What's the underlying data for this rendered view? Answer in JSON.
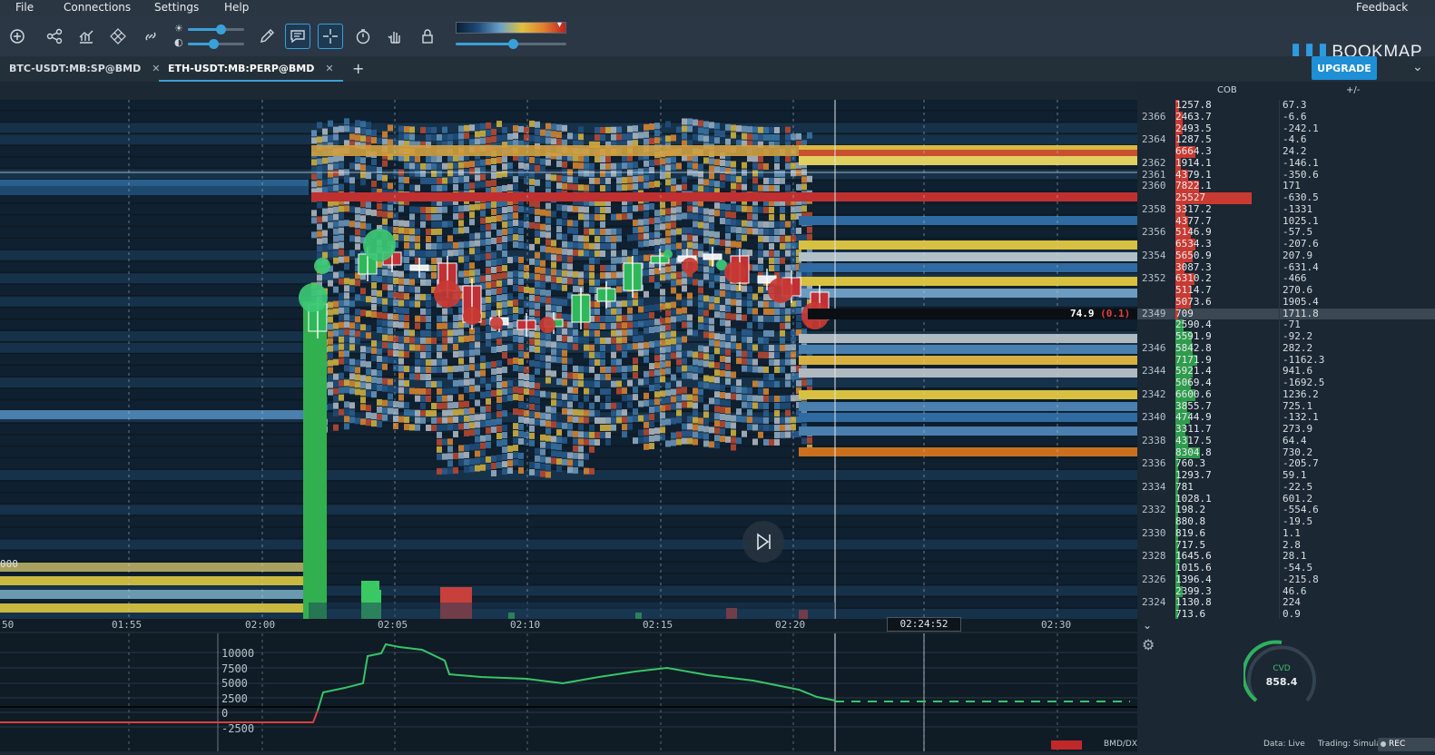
{
  "menu": {
    "file": "File",
    "connections": "Connections",
    "settings": "Settings",
    "help": "Help",
    "feedback": "Feedback"
  },
  "brand": {
    "logo": "BOOKMAP",
    "upgrade": "UPGRADE"
  },
  "tabs": [
    {
      "label": "BTC-USDT:MB:SP@BMD",
      "active": false
    },
    {
      "label": "ETH-USDT:MB:PERP@BMD",
      "active": true
    }
  ],
  "time_axis": {
    "ticks": [
      "50",
      "01:55",
      "02:00",
      "02:05",
      "02:10",
      "02:15",
      "02:20",
      "02:30"
    ],
    "cursor_time": "02:24:52"
  },
  "price_marker": {
    "value": "74.9",
    "change": "(0.1)"
  },
  "left_edge_label": "000",
  "dom": {
    "header_cob": "COB",
    "header_delta": "+/-",
    "rows": [
      {
        "price": "",
        "vol": "1257.8",
        "delta": "67.3"
      },
      {
        "price": "2366",
        "vol": "2463.7",
        "delta": "-6.6"
      },
      {
        "price": "",
        "vol": "2493.5",
        "delta": "-242.1"
      },
      {
        "price": "2364",
        "vol": "1287.5",
        "delta": "-4.6"
      },
      {
        "price": "",
        "vol": "6664.3",
        "delta": "24.2"
      },
      {
        "price": "2362",
        "vol": "1914.1",
        "delta": "-146.1"
      },
      {
        "price": "2361",
        "vol": "4379.1",
        "delta": "-350.6"
      },
      {
        "price": "2360",
        "vol": "7822.1",
        "delta": "171"
      },
      {
        "price": "",
        "vol": "25527",
        "delta": "-630.5"
      },
      {
        "price": "2358",
        "vol": "3317.2",
        "delta": "-1331"
      },
      {
        "price": "",
        "vol": "4377.7",
        "delta": "1025.1"
      },
      {
        "price": "2356",
        "vol": "5146.9",
        "delta": "-57.5"
      },
      {
        "price": "",
        "vol": "6534.3",
        "delta": "-207.6"
      },
      {
        "price": "2354",
        "vol": "5650.9",
        "delta": "207.9"
      },
      {
        "price": "",
        "vol": "3087.3",
        "delta": "-631.4"
      },
      {
        "price": "2352",
        "vol": "6310.2",
        "delta": "-466"
      },
      {
        "price": "",
        "vol": "5114.7",
        "delta": "270.6"
      },
      {
        "price": "",
        "vol": "5073.6",
        "delta": "1905.4"
      },
      {
        "price": "2349",
        "vol": "709",
        "delta": "1711.8"
      },
      {
        "price": "",
        "vol": "2590.4",
        "delta": "-71"
      },
      {
        "price": "",
        "vol": "5591.9",
        "delta": "-92.2"
      },
      {
        "price": "2346",
        "vol": "5842.8",
        "delta": "282.2"
      },
      {
        "price": "",
        "vol": "7171.9",
        "delta": "-1162.3"
      },
      {
        "price": "2344",
        "vol": "5921.4",
        "delta": "941.6"
      },
      {
        "price": "",
        "vol": "5069.4",
        "delta": "-1692.5"
      },
      {
        "price": "2342",
        "vol": "6600.6",
        "delta": "1236.2"
      },
      {
        "price": "",
        "vol": "3855.7",
        "delta": "725.1"
      },
      {
        "price": "2340",
        "vol": "4744.9",
        "delta": "-132.1"
      },
      {
        "price": "",
        "vol": "3311.7",
        "delta": "273.9"
      },
      {
        "price": "2338",
        "vol": "4317.5",
        "delta": "64.4"
      },
      {
        "price": "",
        "vol": "8304.8",
        "delta": "730.2"
      },
      {
        "price": "2336",
        "vol": "760.3",
        "delta": "-205.7"
      },
      {
        "price": "",
        "vol": "1293.7",
        "delta": "59.1"
      },
      {
        "price": "2334",
        "vol": "781",
        "delta": "-22.5"
      },
      {
        "price": "",
        "vol": "1028.1",
        "delta": "601.2"
      },
      {
        "price": "2332",
        "vol": "198.2",
        "delta": "-554.6"
      },
      {
        "price": "",
        "vol": "880.8",
        "delta": "-19.5"
      },
      {
        "price": "2330",
        "vol": "819.6",
        "delta": "1.1"
      },
      {
        "price": "",
        "vol": "717.5",
        "delta": "2.8"
      },
      {
        "price": "2328",
        "vol": "1645.6",
        "delta": "28.1"
      },
      {
        "price": "",
        "vol": "1015.6",
        "delta": "-54.5"
      },
      {
        "price": "2326",
        "vol": "1396.4",
        "delta": "-215.8"
      },
      {
        "price": "",
        "vol": "2399.3",
        "delta": "46.6"
      },
      {
        "price": "2324",
        "vol": "1130.8",
        "delta": "224"
      },
      {
        "price": "",
        "vol": "713.6",
        "delta": "0.9"
      }
    ]
  },
  "cvd_axis": [
    "10000",
    "7500",
    "5000",
    "2500",
    "0",
    "-2500"
  ],
  "cvd_gauge": {
    "label": "CVD",
    "value": "858.4"
  },
  "status": {
    "source": "BMD/DX",
    "data": "Data: Live",
    "trading": "Trading: Simulated",
    "rec": "REC"
  }
}
